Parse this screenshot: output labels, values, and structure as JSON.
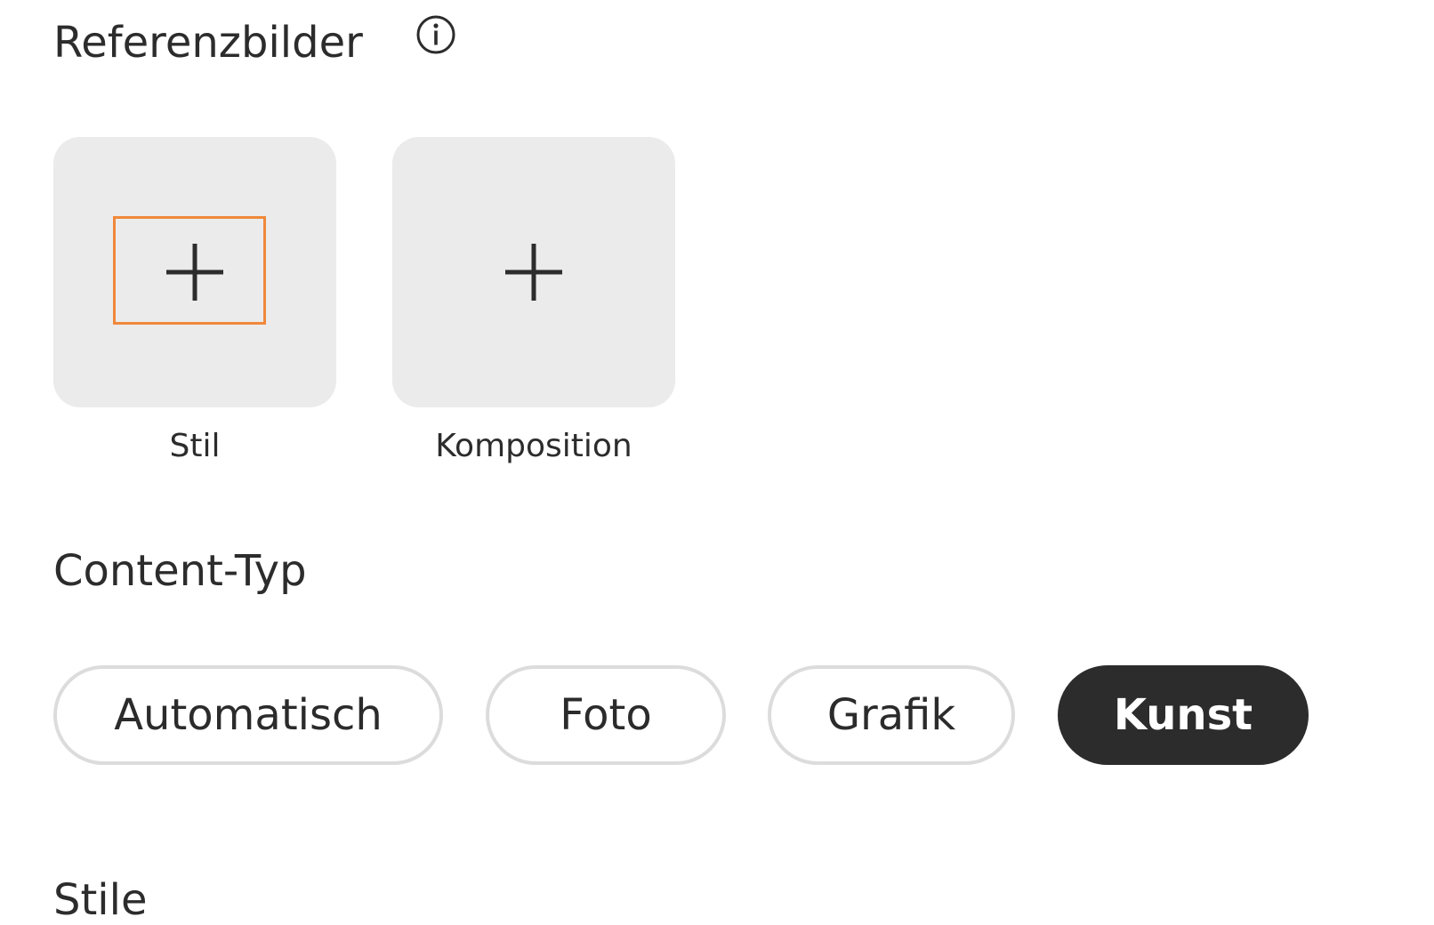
{
  "reference_images": {
    "title": "Referenzbilder",
    "info_icon": "info-icon",
    "tiles": [
      {
        "label": "Stil",
        "icon": "plus-icon"
      },
      {
        "label": "Komposition",
        "icon": "plus-icon"
      }
    ]
  },
  "content_type": {
    "title": "Content-Typ",
    "options": [
      {
        "label": "Automatisch",
        "selected": false
      },
      {
        "label": "Foto",
        "selected": false
      },
      {
        "label": "Grafik",
        "selected": false
      },
      {
        "label": "Kunst",
        "selected": true
      }
    ]
  },
  "styles": {
    "title": "Stile"
  },
  "colors": {
    "focus_outline": "#f0883a",
    "tile_background": "#ebebeb",
    "selected_chip": "#2c2c2c",
    "chip_border": "#dcdcdc"
  }
}
